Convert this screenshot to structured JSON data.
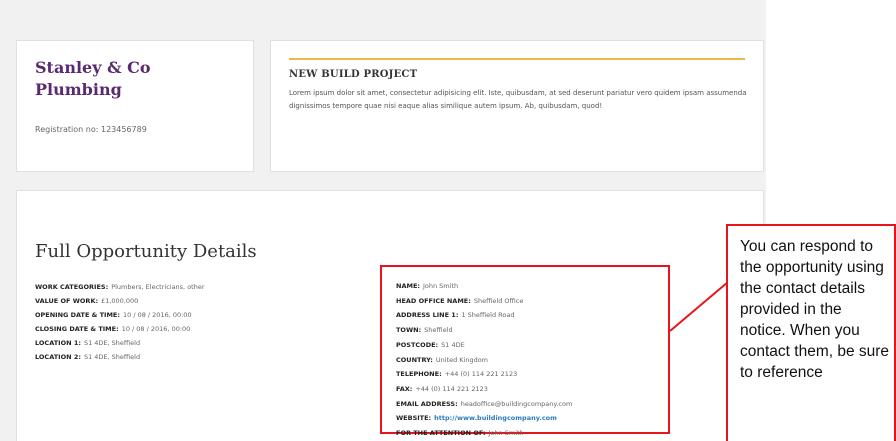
{
  "company": {
    "name": "Stanley & Co Plumbing",
    "registration": "Registration no: 123456789"
  },
  "project": {
    "title": "NEW BUILD PROJECT",
    "description": "Lorem ipsum dolor sit amet, consectetur adipisicing elit. Iste, quibusdam, at sed deserunt pariatur vero quidem ipsam assumenda dignissimos tempore quae nisi eaque alias similique autem ipsum. Ab, quibusdam, quod!",
    "accent_color": "#e8b84a"
  },
  "details": {
    "heading": "Full Opportunity Details",
    "fields": [
      {
        "label": "Work categories:",
        "value": "Plumbers, Electricians, other"
      },
      {
        "label": "Value of work:",
        "value": "£1,000,000"
      },
      {
        "label": "Opening date & time:",
        "value": "10 / 08 / 2016, 00:00"
      },
      {
        "label": "Closing date & time:",
        "value": "10 / 08 / 2016, 00:00"
      },
      {
        "label": "Location 1:",
        "value": "S1 4DE, Sheffield"
      },
      {
        "label": "Location 2:",
        "value": "S1 4DE, Sheffield"
      }
    ]
  },
  "contact": {
    "rows": [
      {
        "label": "Name:",
        "value": "John Smith"
      },
      {
        "label": "Head office name:",
        "value": "Sheffield Office"
      },
      {
        "label": "Address line 1:",
        "value": "1 Sheffield Road"
      },
      {
        "label": "Town:",
        "value": "Sheffield"
      },
      {
        "label": "Postcode:",
        "value": "S1 4DE"
      },
      {
        "label": "Country:",
        "value": "United Kingdom"
      },
      {
        "label": "Telephone:",
        "value": "+44 (0) 114 221 2123"
      },
      {
        "label": "Fax:",
        "value": "+44 (0) 114 221 2123"
      },
      {
        "label": "Email address:",
        "value": "headoffice@buildingcompany.com"
      }
    ],
    "website_label": "Website:",
    "website_value": "http://www.buildingcompany.com",
    "attention_label": "For the attention of:",
    "attention_value": "John Smith",
    "highlight_color": "#e8141c"
  },
  "callout": {
    "text": "You can respond to the opportunity using the contact details provided in the notice. When you contact them, be sure to reference"
  }
}
